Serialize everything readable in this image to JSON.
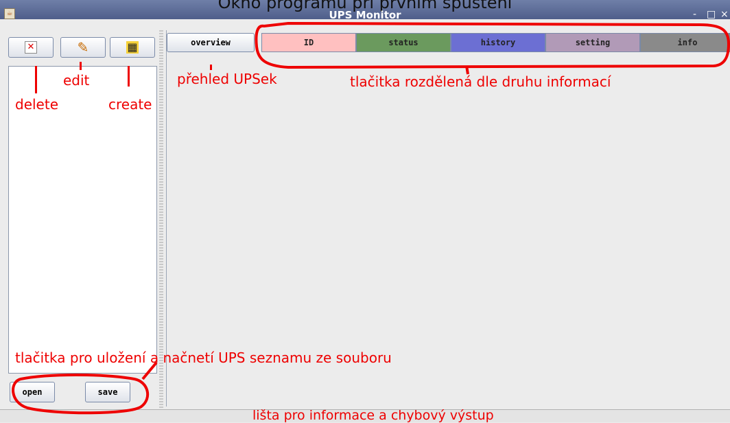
{
  "window": {
    "caption": "Okno programu při prvním spuštění",
    "title": "UPS Monitor",
    "controls": [
      "-",
      "□",
      "×"
    ]
  },
  "toolbar": {
    "delete": {
      "icon": "delete-x-icon",
      "glyph": "✕"
    },
    "edit": {
      "icon": "pencil-icon",
      "glyph": "✎"
    },
    "create": {
      "icon": "new-document-icon",
      "glyph": "▦"
    }
  },
  "file_buttons": {
    "open_label": "open",
    "save_label": "save"
  },
  "overview_label": "overview",
  "tabs": [
    {
      "label": "ID",
      "color": "#ffc0c0"
    },
    {
      "label": "status",
      "color": "#6b9a5e"
    },
    {
      "label": "history",
      "color": "#6c6fd3"
    },
    {
      "label": "setting",
      "color": "#b19ab7"
    },
    {
      "label": "info",
      "color": "#8a8a8a"
    }
  ],
  "annotations": {
    "delete": "delete",
    "edit": "edit",
    "create": "create",
    "overview": "přehled UPSek",
    "tabs": "tlačitka rozdělená dle druhu informací",
    "file_buttons": "tlačitka pro uložení a načnetí UPS seznamu ze souboru",
    "status_bar": "lišta pro informace a chybový výstup"
  },
  "colors": {
    "annotation": "#ee0000"
  }
}
